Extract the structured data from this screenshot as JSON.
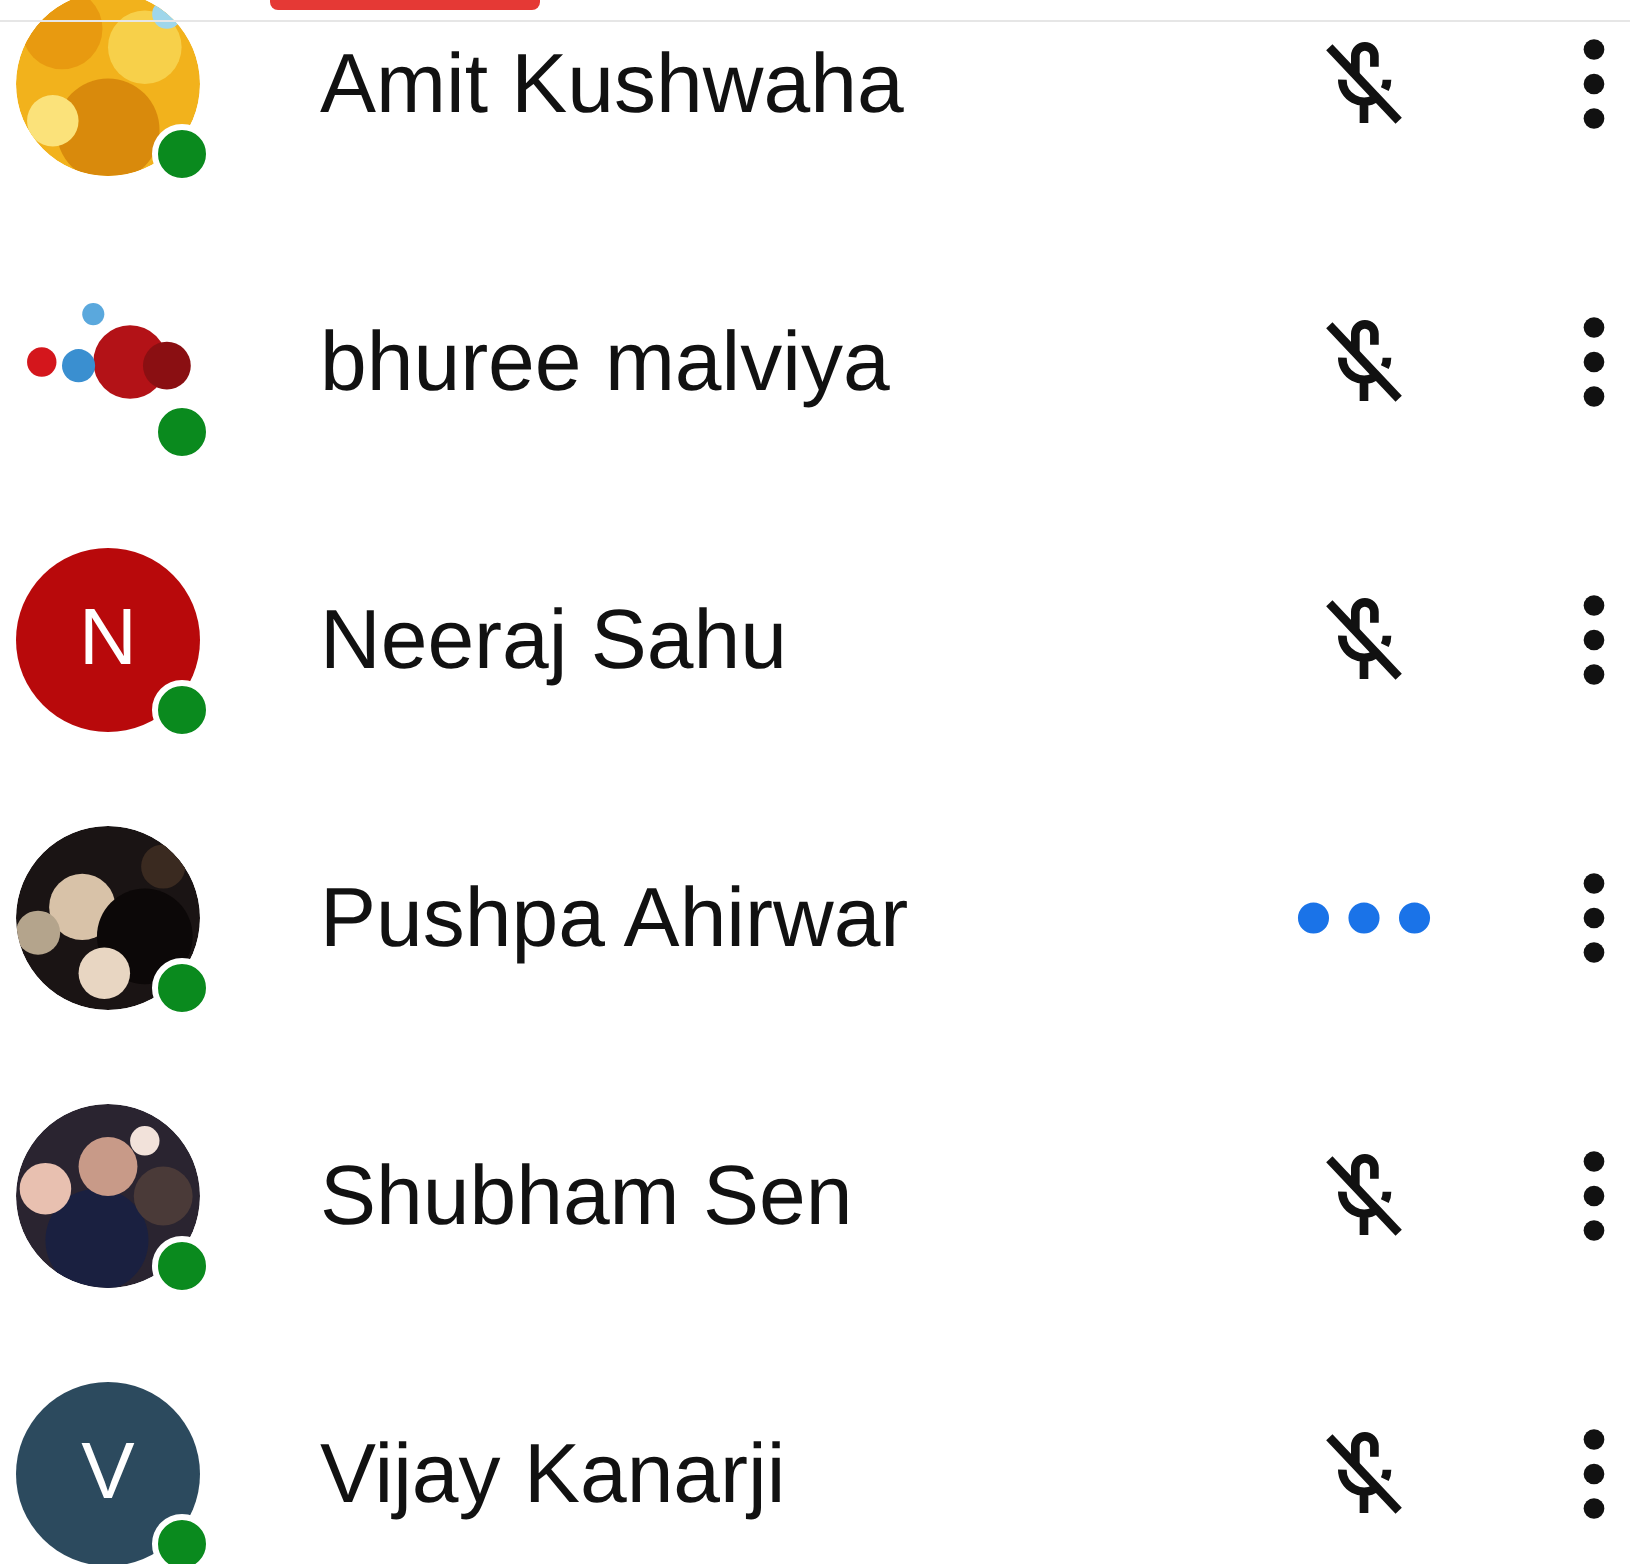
{
  "participants": [
    {
      "name": "Amit Kushwaha",
      "online": true,
      "muted": true
    },
    {
      "name": "bhuree malviya",
      "online": true,
      "muted": true
    },
    {
      "name": "Neeraj Sahu",
      "avatar": {
        "kind": "letter",
        "letter": "N",
        "color": "#b8090b"
      },
      "online": true,
      "muted": true
    },
    {
      "name": "Pushpa Ahirwar",
      "online": true,
      "muted": false
    },
    {
      "name": "Shubham Sen",
      "online": true,
      "muted": true
    },
    {
      "name": "Vijay Kanarji",
      "avatar": {
        "kind": "letter",
        "letter": "V",
        "color": "#2c4a5e"
      },
      "online": true,
      "muted": true
    }
  ]
}
